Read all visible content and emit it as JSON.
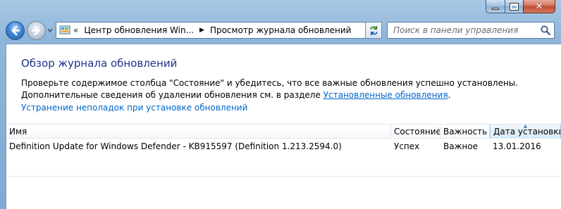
{
  "window": {
    "minimize_glyph": "",
    "maximize_glyph": "",
    "close_glyph": "✕"
  },
  "navbar": {
    "address_chevron": "«",
    "breadcrumbs": [
      {
        "label": "Центр обновления Win..."
      },
      {
        "label": "Просмотр журнала обновлений"
      }
    ],
    "search_placeholder": "Поиск в панели управления"
  },
  "content": {
    "title": "Обзор журнала обновлений",
    "description_prefix": "Проверьте содержимое столбца \"Состояние\" и убедитесь, что все важные обновления успешно установлены. Дополнительные сведения об удалении обновления см. в разделе ",
    "installed_updates_link": "Установленные обновления",
    "description_suffix": ".",
    "troubleshoot_link": "Устранение неполадок при установке обновлений"
  },
  "table": {
    "columns": [
      "Имя",
      "Состояние",
      "Важность",
      "Дата установки"
    ],
    "sorted_column": 3,
    "rows": [
      [
        "Definition Update for Windows Defender - KB915597 (Definition 1.213.2594.0)",
        "Успех",
        "Важное",
        "13.01.2016"
      ]
    ]
  },
  "colors": {
    "title": "#1e3287",
    "link": "#0066cc",
    "frame": "#8fb6da"
  }
}
